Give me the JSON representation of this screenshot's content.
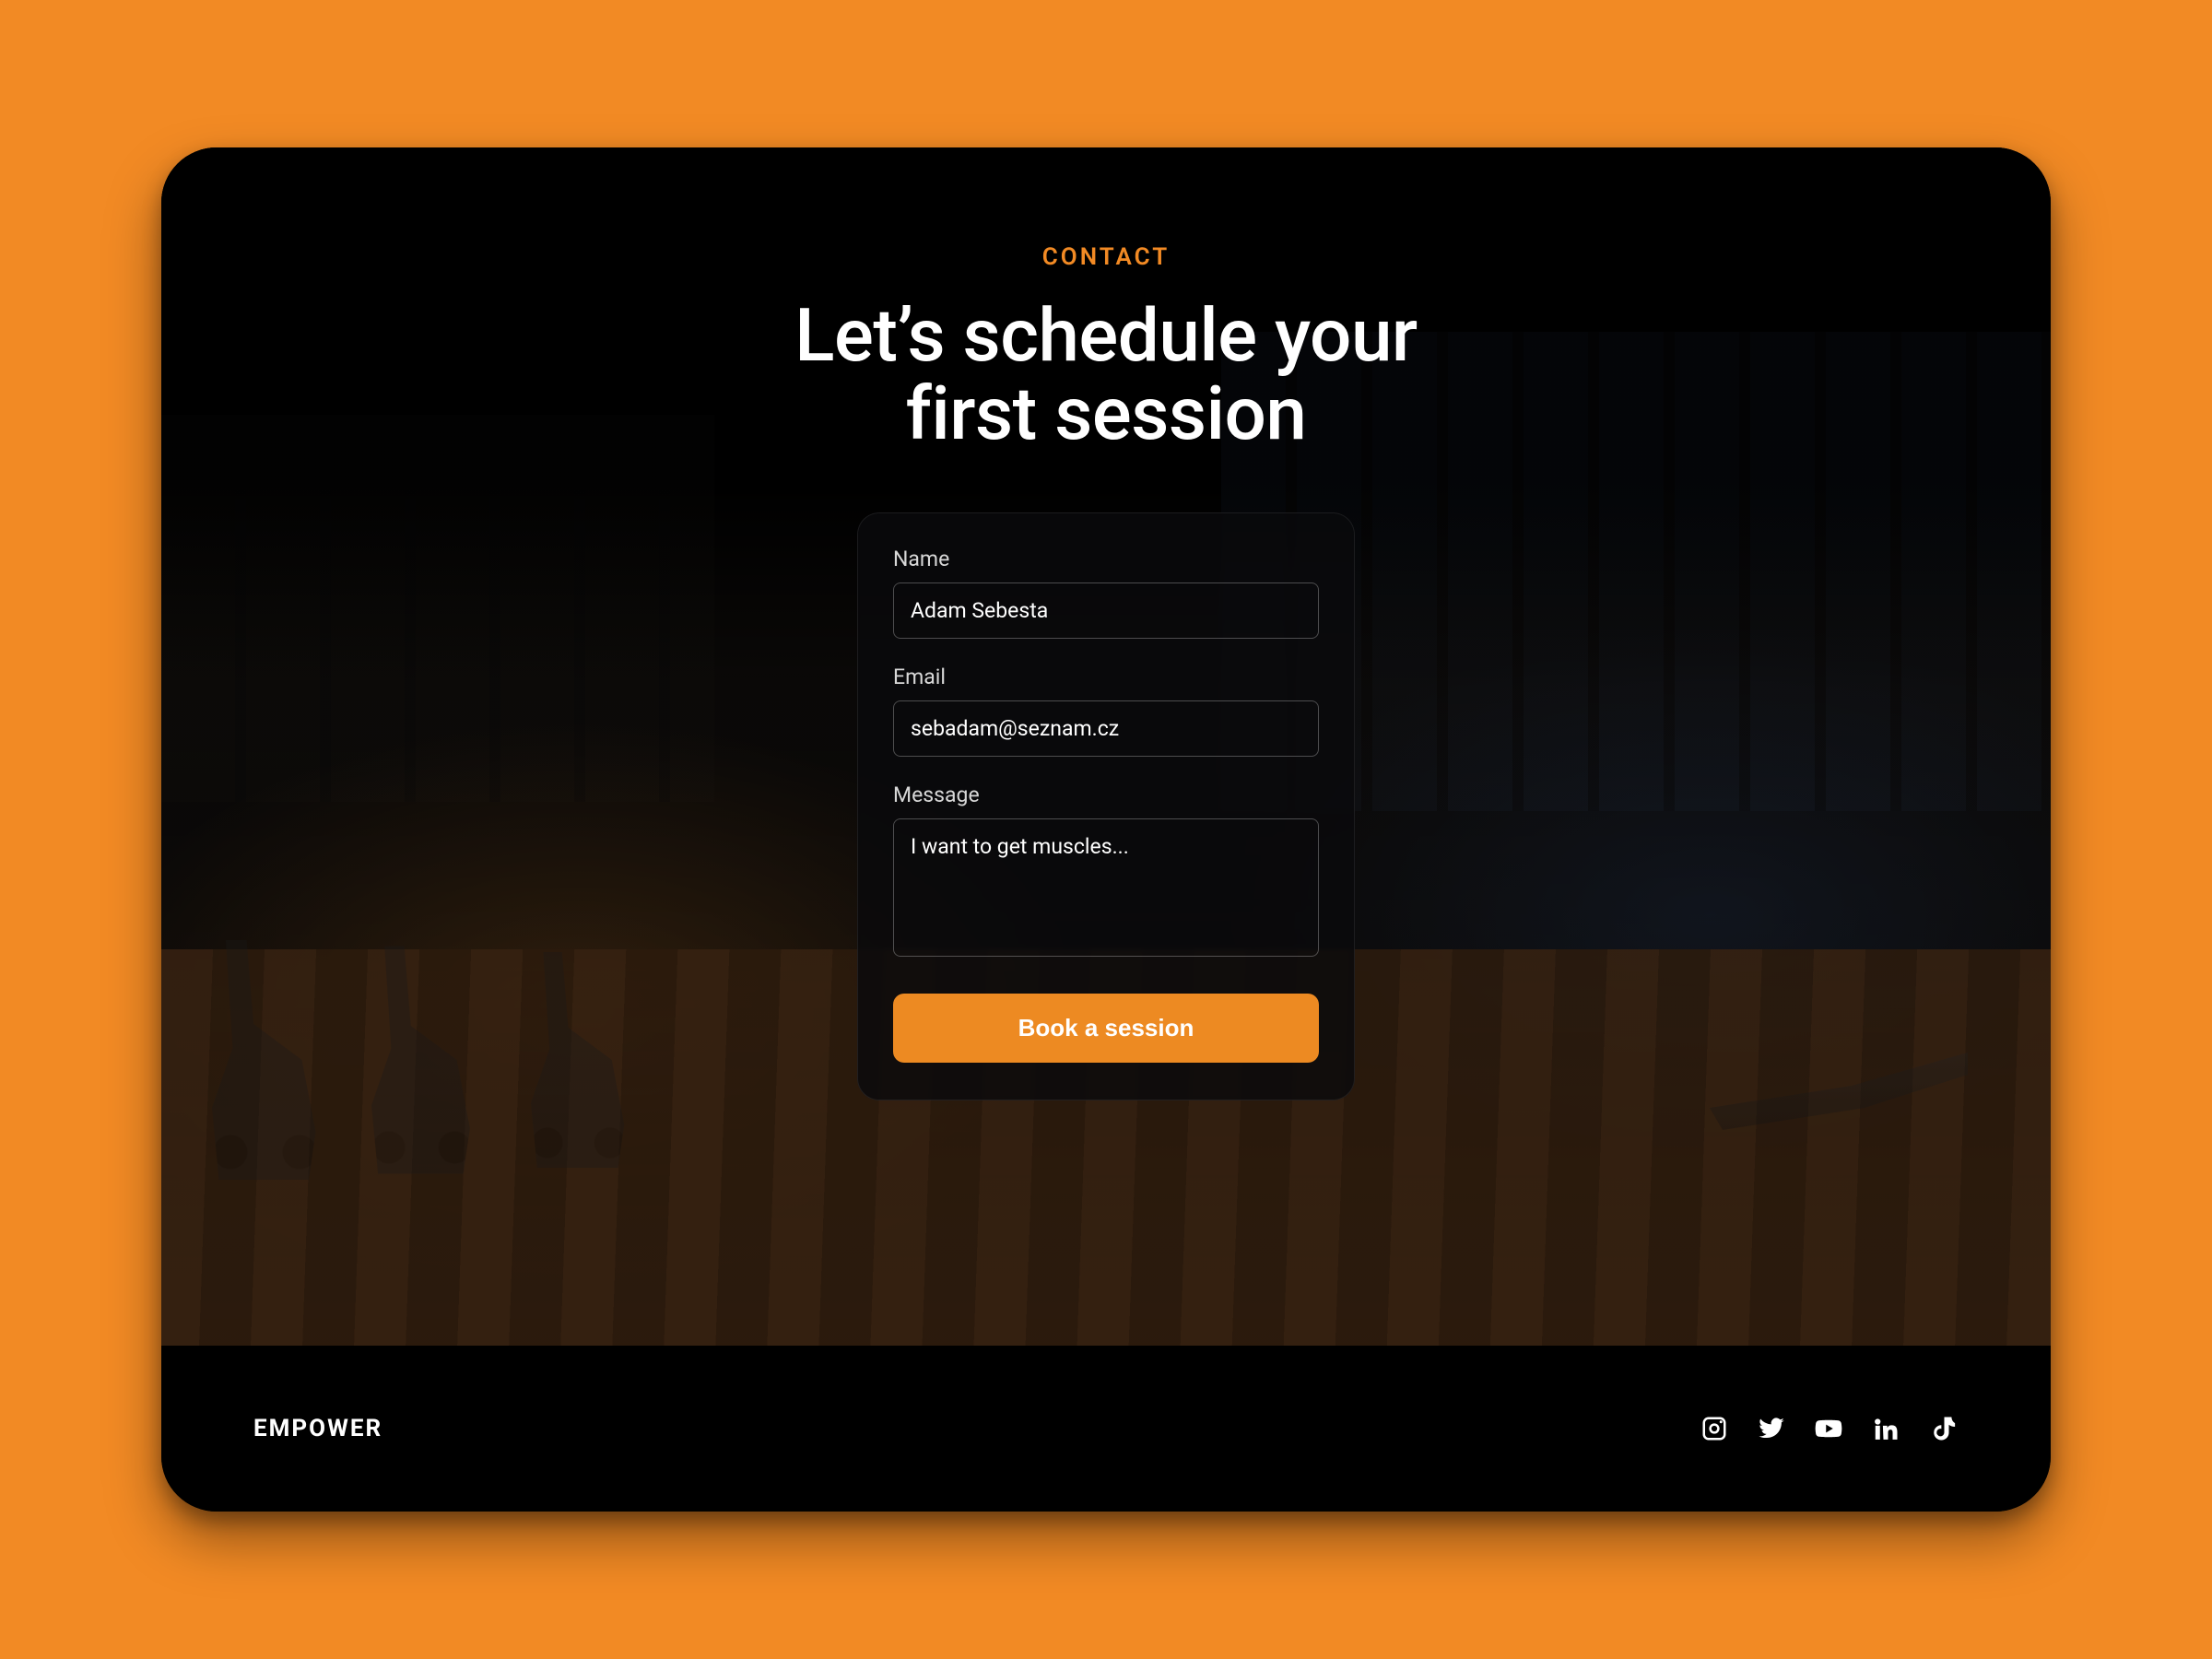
{
  "colors": {
    "accent": "#f28a24",
    "page_bg": "#f28a24",
    "card_bg": "rgba(10,10,12,0.82)"
  },
  "hero": {
    "eyebrow": "CONTACT",
    "headline_line1": "Let’s schedule your",
    "headline_line2": "first session"
  },
  "form": {
    "name": {
      "label": "Name",
      "value": "Adam Sebesta"
    },
    "email": {
      "label": "Email",
      "value": "sebadam@seznam.cz"
    },
    "message": {
      "label": "Message",
      "value": "I want to get muscles..."
    },
    "submit_label": "Book a session"
  },
  "footer": {
    "brand": "EMPOWER",
    "socials": [
      {
        "name": "instagram"
      },
      {
        "name": "twitter"
      },
      {
        "name": "youtube"
      },
      {
        "name": "linkedin"
      },
      {
        "name": "tiktok"
      }
    ]
  }
}
